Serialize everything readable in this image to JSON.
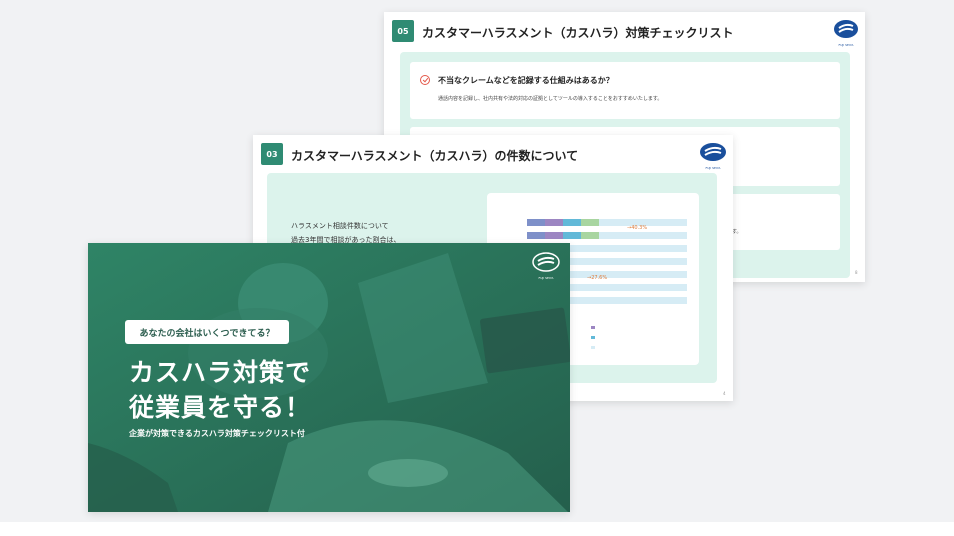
{
  "slide_checklist": {
    "number": "05",
    "title": "カスタマーハラスメント（カスハラ）対策チェックリスト",
    "logo_text": "FUJI SEIYA",
    "item1_question": "不当なクレームなどを記録する仕組みはあるか？",
    "item1_desc": "通話内容を記録し、社内共有や法的対応の証拠としてツールの導入することをおすすめいたします。",
    "item3_desc_tail": "す。",
    "page_number": "8"
  },
  "slide_count": {
    "number": "03",
    "title": "カスタマーハラスメント（カスハラ）の件数について",
    "logo_text": "FUJI SEIYA",
    "text_line1": "ハラスメント相談件数について",
    "text_line2": "過去3年間で相談があった割合は、",
    "page_number": "4",
    "chart_data": {
      "type": "bar",
      "stacked": true,
      "orientation": "horizontal",
      "series_colors": [
        "#7e90c9",
        "#9c86c2",
        "#62b9d8",
        "#a8d5a0",
        "#d6ecf5"
      ],
      "callouts": [
        "→40.3%",
        "→27.6%"
      ]
    }
  },
  "cover": {
    "logo_text": "FUJI SEIYA",
    "question": "あなたの会社はいくつできてる？",
    "headline_line1": "カスハラ対策で",
    "headline_line2": "従業員を守る！",
    "subheadline": "企業が対策できるカスハラ対策チェックリスト付"
  },
  "colors": {
    "accent_green": "#2f8b73",
    "panel_mint": "#dcf3ec",
    "check_red": "#e4584a",
    "cover_green": "#2b7a60"
  }
}
